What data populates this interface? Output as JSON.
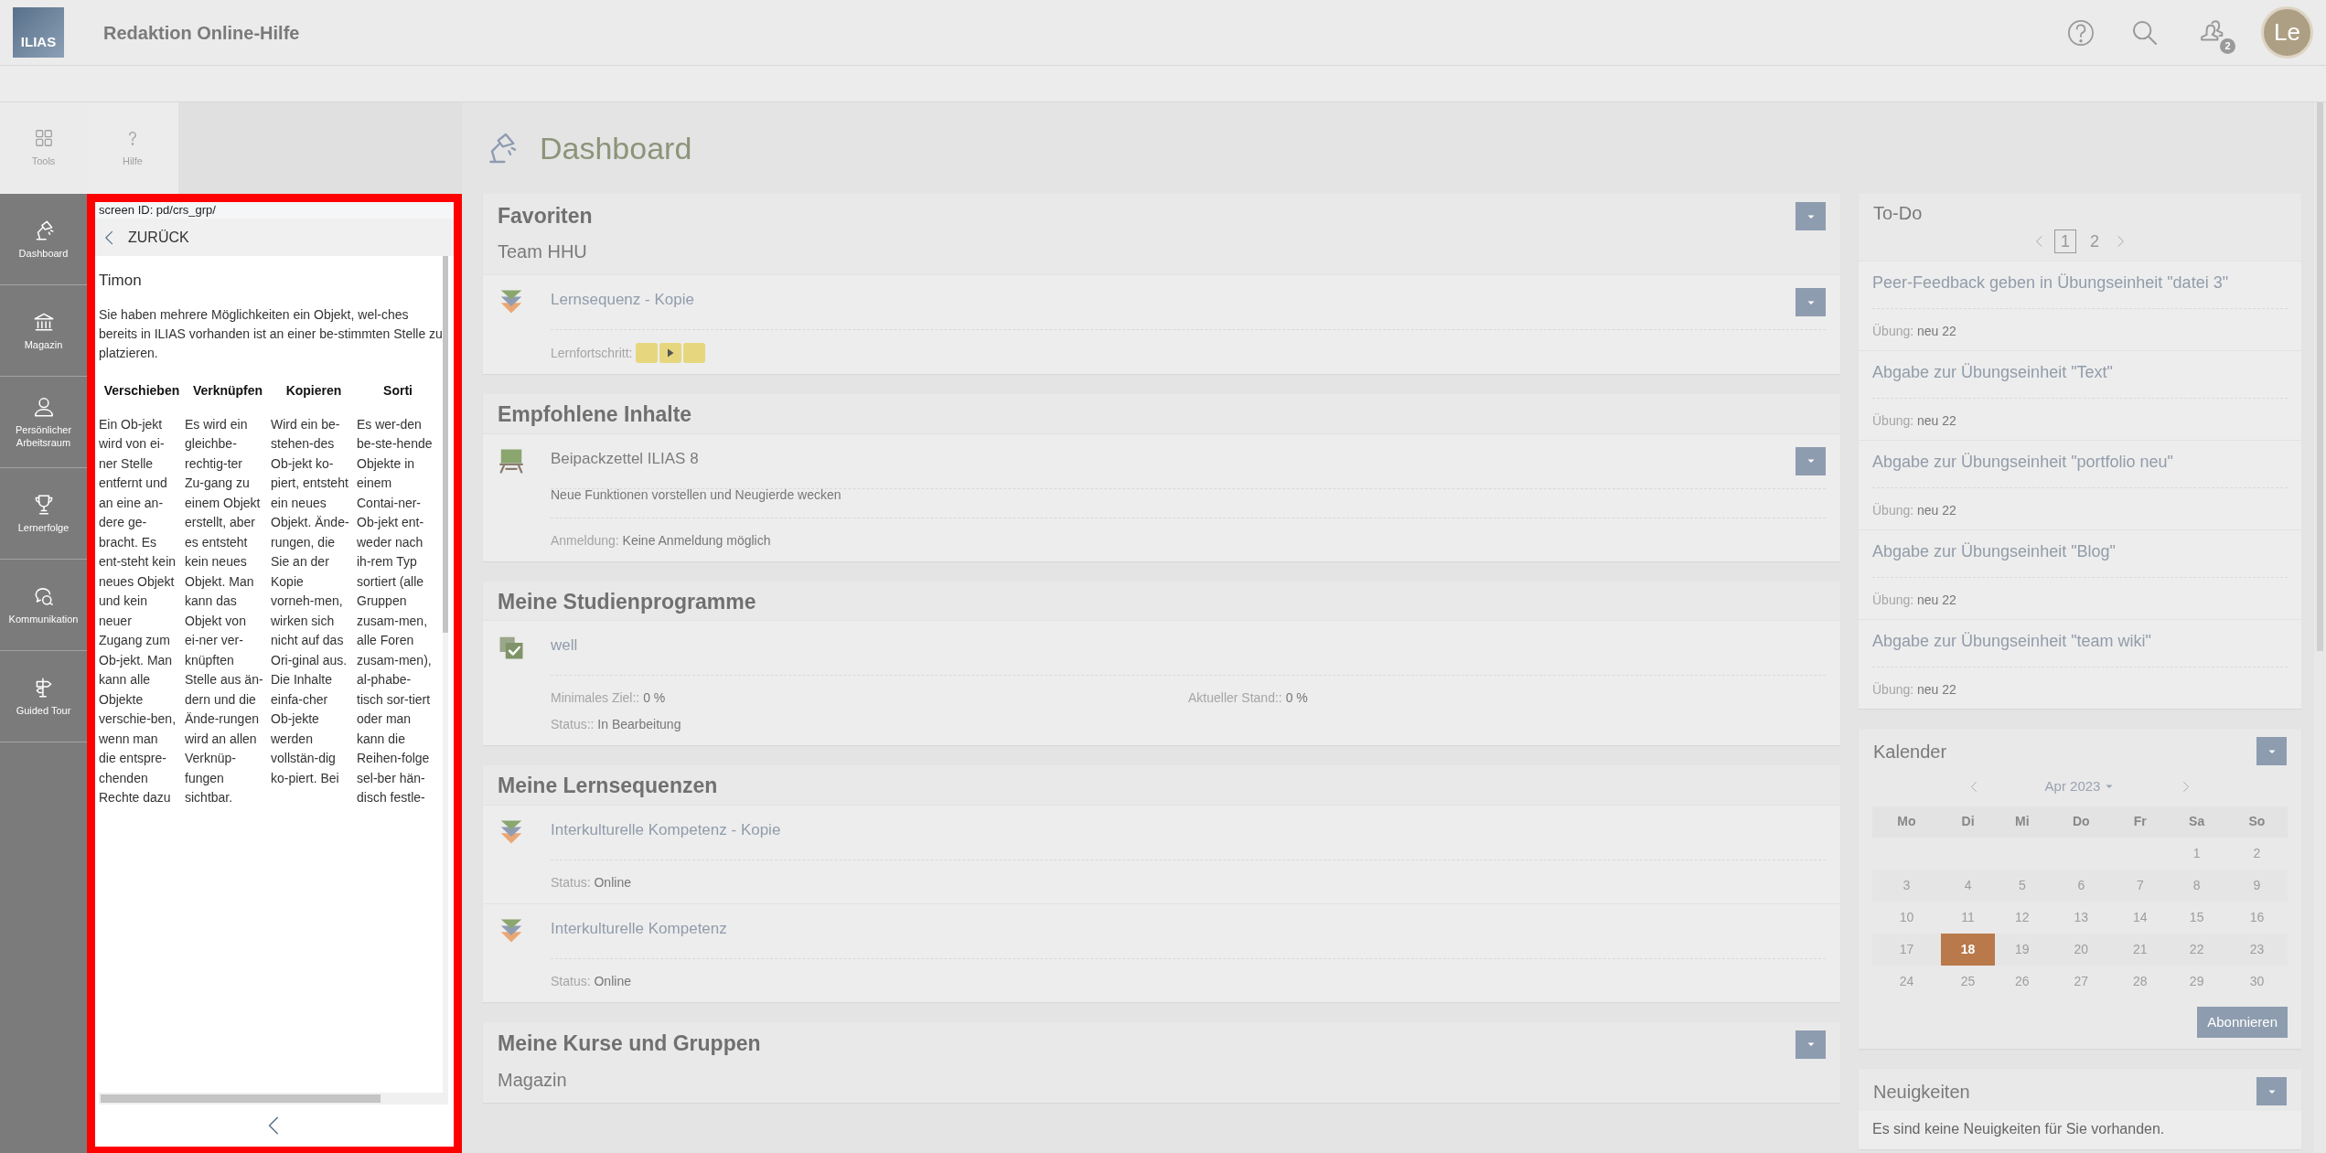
{
  "header": {
    "logo": "ILIAS",
    "title": "Redaktion Online-Hilfe",
    "notification_count": "2",
    "avatar": "Le"
  },
  "tools": [
    {
      "label": "Tools"
    },
    {
      "label": "Hilfe"
    }
  ],
  "mainbar": [
    {
      "label": "Dashboard"
    },
    {
      "label": "Magazin"
    },
    {
      "label": "Persönlicher Arbeitsraum"
    },
    {
      "label": "Lernerfolge"
    },
    {
      "label": "Kommunikation"
    },
    {
      "label": "Guided Tour"
    }
  ],
  "help": {
    "screen_id": "screen ID: pd/crs_grp/",
    "back": "ZURÜCK",
    "title": "Timon",
    "intro": "Sie haben mehrere Möglichkeiten ein Objekt, wel-ches bereits in ILIAS vorhanden ist an einer be-stimmten Stelle zu platzieren.",
    "columns": [
      {
        "heading": "Verschieben",
        "text": "Ein Ob-jekt wird von ei-ner Stelle entfernt und an eine an-dere ge-bracht. Es ent-steht kein neues Objekt und kein neuer Zugang zum Ob-jekt. Man kann alle Objekte verschie-ben, wenn man die entspre-chenden Rechte dazu"
      },
      {
        "heading": "Verknüpfen",
        "text": "Es wird ein gleichbe-rechtig-ter Zu-gang zu einem Objekt erstellt, aber es entsteht kein neues Objekt. Man kann das Objekt von ei-ner ver-knüpften Stelle aus än-dern und die Ände-rungen wird an allen Verknüp-fungen sichtbar."
      },
      {
        "heading": "Kopieren",
        "text": "Wird ein be-stehen-des Ob-jekt ko-piert, entsteht ein neues Objekt. Ände-rungen, die Sie an der Kopie vorneh-men, wirken sich nicht auf das Ori-ginal aus. Die Inhalte einfa-cher Ob-jekte werden vollstän-dig ko-piert. Bei"
      },
      {
        "heading": "Sorti",
        "text": "Es wer-den be-ste-hende Objekte in einem Contai-ner-Ob-jekt ent-weder nach ih-rem Typ sortiert (alle Gruppen zusam-men, alle Foren zusam-men), al-phabe-tisch sor-tiert oder man kann die Reihen-folge sel-ber hän-disch festle-"
      }
    ]
  },
  "page_title": "Dashboard",
  "blocks": [
    {
      "title": "Favoriten",
      "dropdown": true,
      "subtitle": "Team HHU",
      "items": [
        {
          "kind": "sequence",
          "title": "Lernsequenz - Kopie",
          "link": true,
          "dropdown": true,
          "properties": [
            {
              "kind": "progress",
              "label": "Lernfortschritt:",
              "steps": [
                {
                  "current": false
                },
                {
                  "current": true
                },
                {
                  "current": false
                }
              ]
            }
          ]
        }
      ]
    },
    {
      "title": "Empfohlene Inhalte",
      "dropdown": false,
      "items": [
        {
          "kind": "board",
          "title": "Beipackzettel ILIAS 8",
          "link": false,
          "dropdown": true,
          "description": "Neue Funktionen vorstellen und Neugierde wecken",
          "properties": [
            {
              "kind": "text",
              "label": "Anmeldung:",
              "value": "Keine Anmeldung möglich"
            }
          ]
        }
      ]
    },
    {
      "title": "Meine Studienprogramme",
      "dropdown": false,
      "items": [
        {
          "kind": "program",
          "title": "well",
          "link": true,
          "dropdown": false,
          "properties": [
            {
              "kind": "text",
              "label": "Minimales Ziel::",
              "value": "0 %"
            },
            {
              "kind": "text",
              "label": "Aktueller Stand::",
              "value": "0 %"
            },
            {
              "kind": "text",
              "label": "Status::",
              "value": "In Bearbeitung"
            }
          ]
        }
      ]
    },
    {
      "title": "Meine Lernsequenzen",
      "dropdown": false,
      "items": [
        {
          "kind": "sequence",
          "title": "Interkulturelle Kompetenz - Kopie",
          "link": true,
          "dropdown": false,
          "properties": [
            {
              "kind": "text",
              "label": "Status:",
              "value": "Online"
            }
          ]
        },
        {
          "kind": "sequence",
          "title": "Interkulturelle Kompetenz",
          "link": true,
          "dropdown": false,
          "properties": [
            {
              "kind": "text",
              "label": "Status:",
              "value": "Online"
            }
          ]
        }
      ]
    },
    {
      "title": "Meine Kurse und Gruppen",
      "dropdown": true,
      "subtitle": "Magazin"
    }
  ],
  "todo": {
    "title": "To-Do",
    "pages": [
      {
        "label": "1",
        "selected": true
      },
      {
        "label": "2",
        "selected": false
      }
    ],
    "items": [
      {
        "title": "Peer-Feedback geben in Übungseinheit \"datei 3\"",
        "label": "Übung:",
        "value": "neu 22"
      },
      {
        "title": "Abgabe zur Übungseinheit \"Text\"",
        "label": "Übung:",
        "value": "neu 22"
      },
      {
        "title": "Abgabe zur Übungseinheit \"portfolio neu\"",
        "label": "Übung:",
        "value": "neu 22"
      },
      {
        "title": "Abgabe zur Übungseinheit \"Blog\"",
        "label": "Übung:",
        "value": "neu 22"
      },
      {
        "title": "Abgabe zur Übungseinheit \"team wiki\"",
        "label": "Übung:",
        "value": "neu 22"
      }
    ]
  },
  "calendar": {
    "title": "Kalender",
    "dropdown": true,
    "month": "Apr 2023",
    "weekdays": [
      "Mo",
      "Di",
      "Mi",
      "Do",
      "Fr",
      "Sa",
      "So"
    ],
    "weeks": [
      [
        {
          "day": "1",
          "selected": false
        },
        {
          "day": "2",
          "selected": false
        }
      ],
      [
        {
          "day": "3",
          "selected": false
        },
        {
          "day": "4",
          "selected": false
        },
        {
          "day": "5",
          "selected": false
        },
        {
          "day": "6",
          "selected": false
        },
        {
          "day": "7",
          "selected": false
        },
        {
          "day": "8",
          "selected": false
        },
        {
          "day": "9",
          "selected": false
        }
      ],
      [
        {
          "day": "10",
          "selected": false
        },
        {
          "day": "11",
          "selected": false
        },
        {
          "day": "12",
          "selected": false
        },
        {
          "day": "13",
          "selected": false
        },
        {
          "day": "14",
          "selected": false
        },
        {
          "day": "15",
          "selected": false
        },
        {
          "day": "16",
          "selected": false
        }
      ],
      [
        {
          "day": "17",
          "selected": false
        },
        {
          "day": "18",
          "selected": true
        },
        {
          "day": "19",
          "selected": false
        },
        {
          "day": "20",
          "selected": false
        },
        {
          "day": "21",
          "selected": false
        },
        {
          "day": "22",
          "selected": false
        },
        {
          "day": "23",
          "selected": false
        }
      ],
      [
        {
          "day": "24",
          "selected": false
        },
        {
          "day": "25",
          "selected": false
        },
        {
          "day": "26",
          "selected": false
        },
        {
          "day": "27",
          "selected": false
        },
        {
          "day": "28",
          "selected": false
        },
        {
          "day": "29",
          "selected": false
        },
        {
          "day": "30",
          "selected": false
        }
      ]
    ],
    "button": "Abonnieren"
  },
  "news": {
    "title": "Neuigkeiten",
    "dropdown": true,
    "text": "Es sind keine Neuigkeiten für Sie vorhanden."
  }
}
